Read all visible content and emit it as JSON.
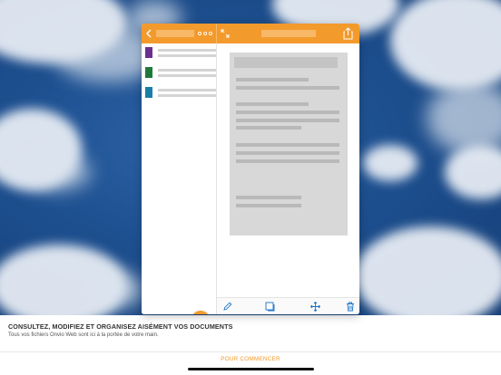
{
  "colors": {
    "accent": "#f39a2c",
    "icon": "#1a73c9",
    "page": "#d8d8d8"
  },
  "left_pane": {
    "back_icon": "chevron-left-icon",
    "more_icon": "ellipsis-icon",
    "add_icon": "plus-icon",
    "files": [
      {
        "color": "#6b2f8f"
      },
      {
        "color": "#1f7a3a"
      },
      {
        "color": "#1a7fa8"
      }
    ]
  },
  "right_pane": {
    "expand_icon": "expand-icon",
    "share_icon": "share-icon",
    "toolbar_icons": [
      "pencil-icon",
      "pages-icon",
      "move-icon",
      "trash-icon"
    ]
  },
  "promo": {
    "heading": "CONSULTEZ, MODIFIEZ ET ORGANISEZ AISÉMENT VOS DOCUMENTS",
    "subtext": "Tous vos fichiers Onvio Web sont ici à la portée de votre main.",
    "cta": "POUR COMMENCER"
  }
}
